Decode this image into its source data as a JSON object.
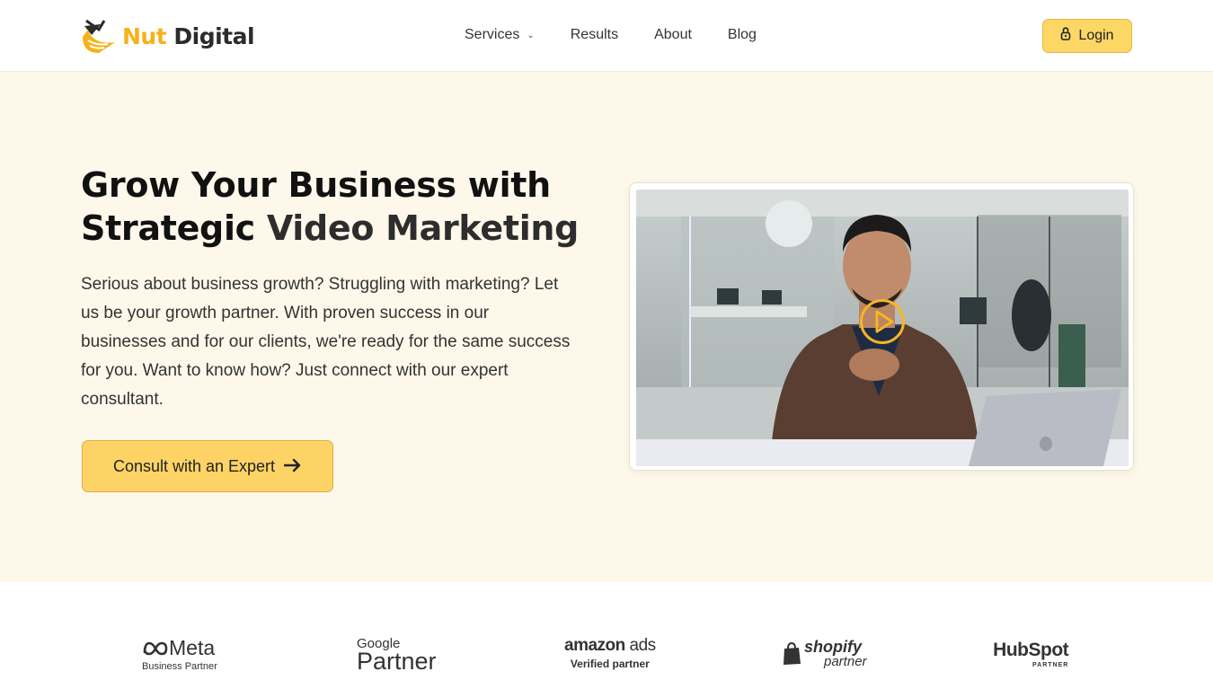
{
  "brand": {
    "name_part1": "Nut",
    "name_part2": "Digital"
  },
  "nav": {
    "items": [
      {
        "label": "Services",
        "has_dropdown": true
      },
      {
        "label": "Results"
      },
      {
        "label": "About"
      },
      {
        "label": "Blog"
      }
    ],
    "login_label": "Login"
  },
  "hero": {
    "title_line1": "Grow Your Business with",
    "title_line2_a": "Strategic",
    "title_line2_b": "Video Marketing",
    "text": "Serious about business growth? Struggling with marketing? Let us be your growth partner. With proven success in our businesses and for our clients, we're ready for the same success for you. Want to know how? Just connect with our expert consultant.",
    "cta_label": "Consult with an Expert"
  },
  "partners": {
    "meta": {
      "name": "Meta",
      "tag": "Business Partner"
    },
    "google": {
      "name": "Google",
      "tag": "Partner"
    },
    "amazon": {
      "name_a": "amazon",
      "name_b": "ads",
      "tag": "Verified partner"
    },
    "shopify": {
      "name": "shopify",
      "tag": "partner"
    },
    "hubspot": {
      "name": "HubSpot",
      "tag": "PARTNER"
    }
  },
  "colors": {
    "accent": "#fdd366",
    "brand_orange": "#f5b21a",
    "hero_bg": "#fdf8ea"
  },
  "icons": {
    "lock": "lock-icon",
    "arrow": "arrow-right-icon",
    "play": "play-icon",
    "chevron": "chevron-down-icon"
  }
}
